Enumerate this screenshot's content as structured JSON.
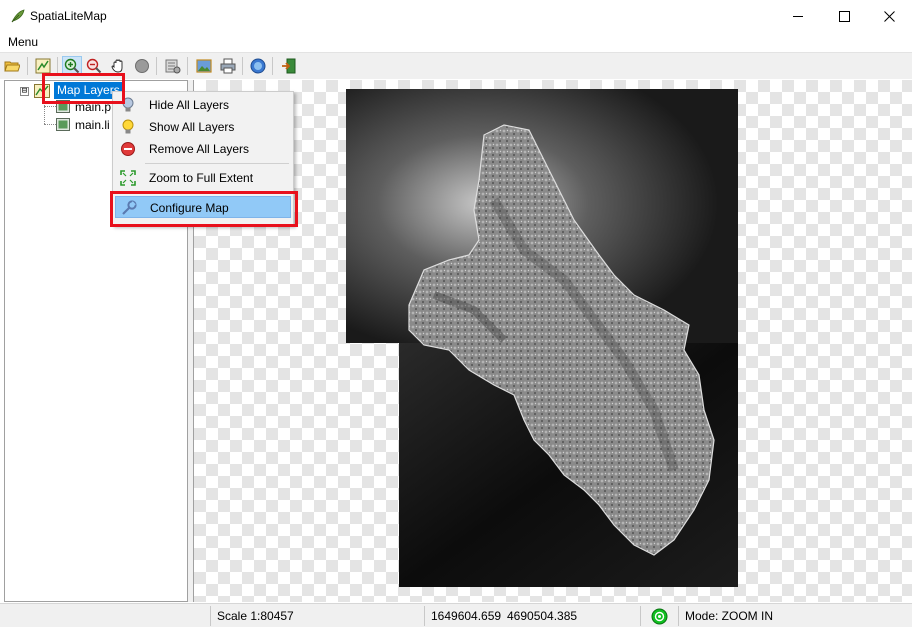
{
  "window": {
    "title": "SpatiaLiteMap",
    "minimize_icon": "minimize-icon",
    "maximize_icon": "maximize-icon",
    "close_icon": "close-icon"
  },
  "menubar": {
    "menu_label": "Menu"
  },
  "toolbar": {
    "buttons": [
      "open-folder-icon",
      "layer-add-icon",
      "zoom-in-icon",
      "zoom-out-icon",
      "pan-hand-icon",
      "identify-icon",
      "settings-icon",
      "image-export-icon",
      "print-icon",
      "help-icon",
      "exit-icon"
    ],
    "active_button": "zoom-in-icon"
  },
  "layer_tree": {
    "expander_symbol": "⊟",
    "root": {
      "label": "Map Layers",
      "selected": true
    },
    "children": [
      {
        "label": "main.p"
      },
      {
        "label": "main.li"
      }
    ]
  },
  "context_menu": {
    "items": [
      {
        "label": "Hide All Layers",
        "icon": "bulb-off-icon"
      },
      {
        "label": "Show All Layers",
        "icon": "bulb-on-icon"
      },
      {
        "label": "Remove All Layers",
        "icon": "remove-icon"
      },
      {
        "label": "Zoom to Full Extent",
        "icon": "zoom-extent-icon"
      },
      {
        "label": "Configure Map",
        "icon": "wrench-icon",
        "highlighted": true
      }
    ]
  },
  "statusbar": {
    "scale": "Scale 1:80457",
    "coord_x": "1649604.659",
    "coord_y": "4690504.385",
    "mode": "Mode: ZOOM IN",
    "status_icon": "gps-status-icon"
  },
  "colors": {
    "selection_blue": "#0078d7",
    "highlight_menu": "#91c9f7",
    "annotation_red": "#e8101c",
    "status_green": "#10c020"
  }
}
